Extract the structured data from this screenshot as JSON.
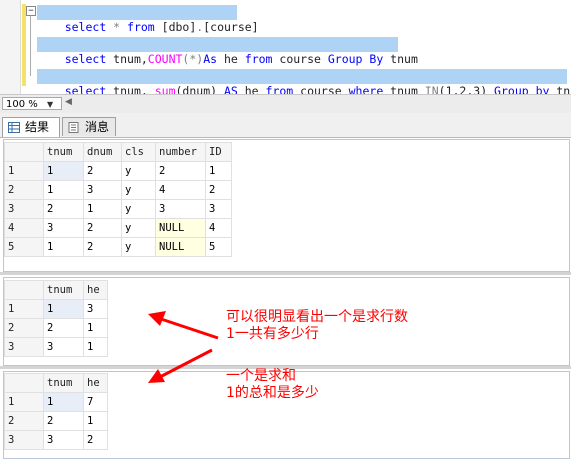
{
  "editor": {
    "lines": [
      {
        "t1": "select ",
        "t2": "*",
        "t3": " from ",
        "t4": "[dbo]",
        "t5": ".",
        "t6": "[course]"
      },
      {
        "t1": "select ",
        "t2": "tnum,",
        "t3": "COUNT",
        "t4": "(*)",
        "t5": "As",
        "t6": " he ",
        "t7": "from",
        "t8": " course ",
        "t9": "Group By",
        "t10": " tnum"
      },
      {
        "t1": "select ",
        "t2": "tnum, ",
        "t3": "sum",
        "t4": "(dnum) ",
        "t5": "AS",
        "t6": " he ",
        "t7": "from",
        "t8": " course ",
        "t9": "where",
        "t10": " tnum ",
        "t11": "IN",
        "t12": "(1,2,3) ",
        "t13": "Group by",
        "t14": " tnum"
      }
    ],
    "fold_symbol": "−"
  },
  "statusbar": {
    "zoom": "100 %",
    "zoom_arrow": "▼",
    "scroll_arrow": "◀"
  },
  "tabs": [
    {
      "label": "结果"
    },
    {
      "label": "消息"
    }
  ],
  "results": [
    {
      "columns": [
        "tnum",
        "dnum",
        "cls",
        "number",
        "ID"
      ],
      "rows": [
        [
          "1",
          "1",
          "2",
          "y",
          "2",
          "1"
        ],
        [
          "2",
          "1",
          "3",
          "y",
          "4",
          "2"
        ],
        [
          "3",
          "2",
          "1",
          "y",
          "3",
          "3"
        ],
        [
          "4",
          "3",
          "2",
          "y",
          "NULL",
          "4"
        ],
        [
          "5",
          "1",
          "2",
          "y",
          "NULL",
          "5"
        ]
      ]
    },
    {
      "columns": [
        "tnum",
        "he"
      ],
      "rows": [
        [
          "1",
          "1",
          "3"
        ],
        [
          "2",
          "2",
          "1"
        ],
        [
          "3",
          "3",
          "1"
        ]
      ]
    },
    {
      "columns": [
        "tnum",
        "he"
      ],
      "rows": [
        [
          "1",
          "1",
          "7"
        ],
        [
          "2",
          "2",
          "1"
        ],
        [
          "3",
          "3",
          "2"
        ]
      ]
    }
  ],
  "annotations": {
    "note1_line1": "可以很明显看出一个是求行数",
    "note1_line2": "1一共有多少行",
    "note2_line1": "一个是求和",
    "note2_line2": "1的总和是多少",
    "color": "#ff0000"
  }
}
